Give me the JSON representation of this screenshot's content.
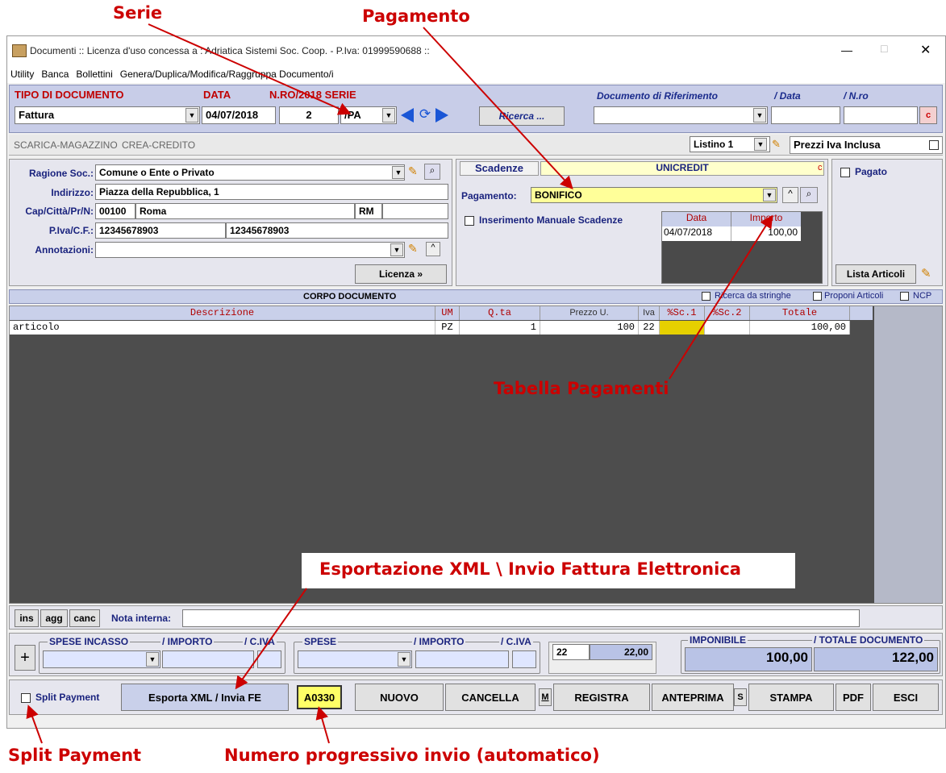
{
  "callouts": {
    "serie": "Serie",
    "pagamento": "Pagamento",
    "tabella_pagamenti": "Tabella Pagamenti",
    "esportazione": "Esportazione XML \\ Invio Fattura Elettronica",
    "split_payment": "Split Payment",
    "numero_progressivo": "Numero progressivo invio (automatico)"
  },
  "window": {
    "title": "Documenti  :: Licenza d'uso concessa a : Adriatica Sistemi Soc. Coop. - P.Iva: 01999590688 ::",
    "minimize": "—",
    "maximize": "□",
    "close": "✕"
  },
  "menu": [
    "Utility",
    "Banca",
    "Bollettini",
    "Genera/Duplica/Modifica/Raggruppa Documento/i"
  ],
  "header": {
    "tipo_label": "TIPO DI DOCUMENTO",
    "data_label": "DATA",
    "nro_label": "N.RO/2018 SERIE",
    "rif_label": "Documento di Riferimento",
    "rif_data_label": "/ Data",
    "rif_nro_label": "/ N.ro",
    "tipo_value": "Fattura",
    "data_value": "04/07/2018",
    "nro_value": "2",
    "serie_value": "/PA",
    "ricerca": "Ricerca ...",
    "c_button": "c"
  },
  "strip": {
    "scarica": "SCARICA-MAGAZZINO",
    "crea": "CREA-CREDITO",
    "listino": "Listino 1",
    "prezzi_iva": "Prezzi Iva Inclusa"
  },
  "cliente": {
    "ragione_label": "Ragione Soc.:",
    "ragione_value": "Comune o Ente o Privato",
    "indirizzo_label": "Indirizzo:",
    "indirizzo_value": "Piazza della Repubblica, 1",
    "cap_label": "Cap/Città/Pr/N:",
    "cap_value": "00100",
    "citta_value": "Roma",
    "prov_value": "RM",
    "piva_label": "P.Iva/C.F.:",
    "piva_value": "12345678903",
    "cf_value": "12345678903",
    "annotazioni_label": "Annotazioni:",
    "licenza": "Licenza »"
  },
  "scadenze": {
    "tab": "Scadenze",
    "banca": "UNICREDIT",
    "c": "c",
    "pagamento_label": "Pagamento:",
    "pagamento_value": "BONIFICO",
    "manuale": "Inserimento Manuale Scadenze",
    "col_data": "Data",
    "col_importo": "Importo",
    "row_data": "04/07/2018",
    "row_importo": "100,00"
  },
  "right_panel": {
    "pagato": "Pagato",
    "lista_articoli": "Lista Articoli"
  },
  "corpo": {
    "title": "CORPO DOCUMENTO",
    "ricerca_stringhe": "Ricerca da stringhe",
    "proponi": "Proponi Articoli",
    "ncp": "NCP",
    "columns": [
      "Descrizione",
      "UM",
      "Q.ta",
      "Prezzo U.",
      "Iva",
      "%Sc.1",
      "%Sc.2",
      "Totale"
    ],
    "row": {
      "descrizione": "articolo",
      "um": "PZ",
      "qta": "1",
      "prezzo": "100",
      "iva": "22",
      "sc1": "",
      "sc2": "",
      "totale": "100,00"
    }
  },
  "nota": {
    "ins": "ins",
    "agg": "agg",
    "canc": "canc",
    "label": "Nota interna:"
  },
  "totali": {
    "plus": "+",
    "spese_incasso": "SPESE INCASSO",
    "importo1": "/ IMPORTO",
    "civa1": "/ C.IVA",
    "spese": "SPESE",
    "importo2": "/ IMPORTO",
    "civa2": "/ C.IVA",
    "iva_code": "22",
    "iva_amount": "22,00",
    "imponibile_label": "IMPONIBILE",
    "totale_label": "/ TOTALE DOCUMENTO",
    "imponibile": "100,00",
    "totale": "122,00"
  },
  "buttons": {
    "split": "Split Payment",
    "esporta": "Esporta XML / Invia FE",
    "progressivo": "A0330",
    "nuovo": "NUOVO",
    "cancella": "CANCELLA",
    "m": "M",
    "registra": "REGISTRA",
    "anteprima": "ANTEPRIMA",
    "s": "S",
    "stampa": "STAMPA",
    "pdf": "PDF",
    "esci": "ESCI"
  },
  "colors": {
    "accent_red": "#cc0000",
    "header_blue": "#c8cde8",
    "yellow_field": "#ffff99"
  }
}
